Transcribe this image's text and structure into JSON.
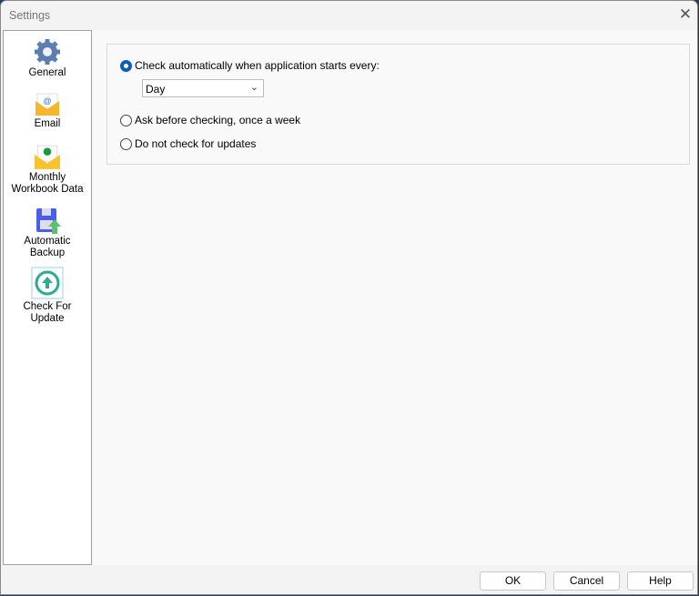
{
  "window": {
    "title": "Settings",
    "close_label": "✕"
  },
  "sidebar": {
    "items": [
      {
        "label1": "General",
        "label2": ""
      },
      {
        "label1": "Email",
        "label2": ""
      },
      {
        "label1": "Monthly",
        "label2": "Workbook Data"
      },
      {
        "label1": "Automatic",
        "label2": "Backup"
      },
      {
        "label1": "Check For",
        "label2": "Update"
      }
    ],
    "selected": "Check For Update"
  },
  "update": {
    "options": [
      {
        "label": "Check automatically when application starts every:",
        "checked": true
      },
      {
        "label": "Ask before checking, once a week",
        "checked": false
      },
      {
        "label": "Do not check for updates",
        "checked": false
      }
    ],
    "frequency": "Day"
  },
  "buttons": {
    "ok": "OK",
    "cancel": "Cancel",
    "help": "Help"
  },
  "colors": {
    "accent": "#0a5fb4"
  }
}
